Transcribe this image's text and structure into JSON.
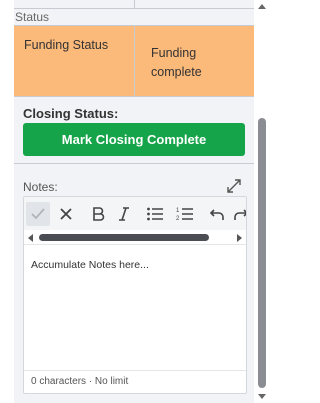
{
  "status_section": {
    "label": "Status",
    "row": {
      "name": "Funding Status",
      "value": "Funding complete"
    }
  },
  "closing": {
    "label": "Closing Status:",
    "button_label": "Mark Closing Complete",
    "button_color": "#16a44a"
  },
  "notes": {
    "label": "Notes:",
    "expand_icon": "expand-diagonal-icon",
    "toolbar": [
      "check-icon",
      "close-icon",
      "bold-icon",
      "italic-icon",
      "bullet-list-icon",
      "numbered-list-icon",
      "undo-icon",
      "redo-icon"
    ],
    "content_placeholder": "Accumulate Notes here...",
    "status": "0 characters · No limit"
  },
  "colors": {
    "status_bg": "#fbb97a",
    "panel_bg": "#f1f3f6"
  }
}
